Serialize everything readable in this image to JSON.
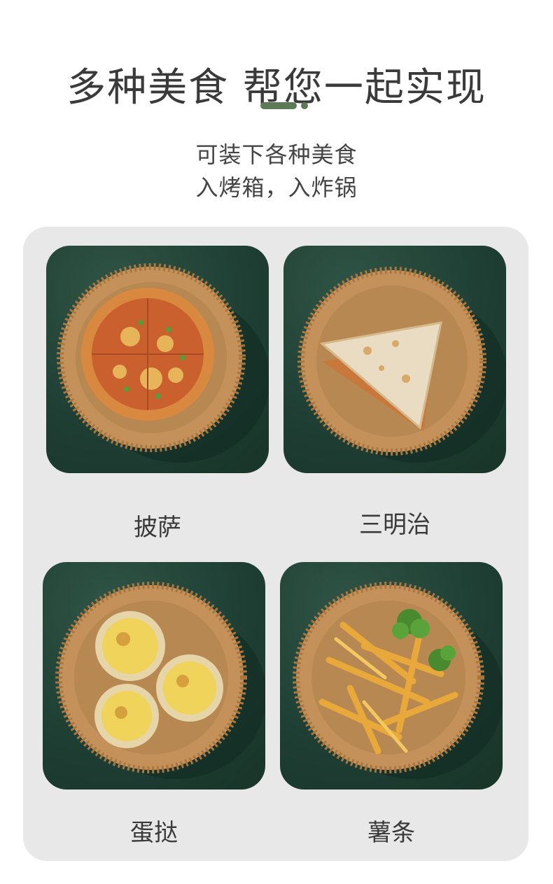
{
  "header": {
    "title": "多种美食 帮您一起实现",
    "subtitle_line1": "可装下各种美食",
    "subtitle_line2": "入烤箱，入炸锅"
  },
  "foods": [
    {
      "name": "披萨",
      "icon": "pizza-icon"
    },
    {
      "name": "三明治",
      "icon": "sandwich-icon"
    },
    {
      "name": "蛋挞",
      "icon": "egg-tart-icon"
    },
    {
      "name": "薯条",
      "icon": "fries-icon"
    }
  ],
  "colors": {
    "accent": "#5d7a57",
    "tile_background": "#1f3f34",
    "panel_background": "#e8e8e8",
    "paper_liner": "#c99a62"
  }
}
